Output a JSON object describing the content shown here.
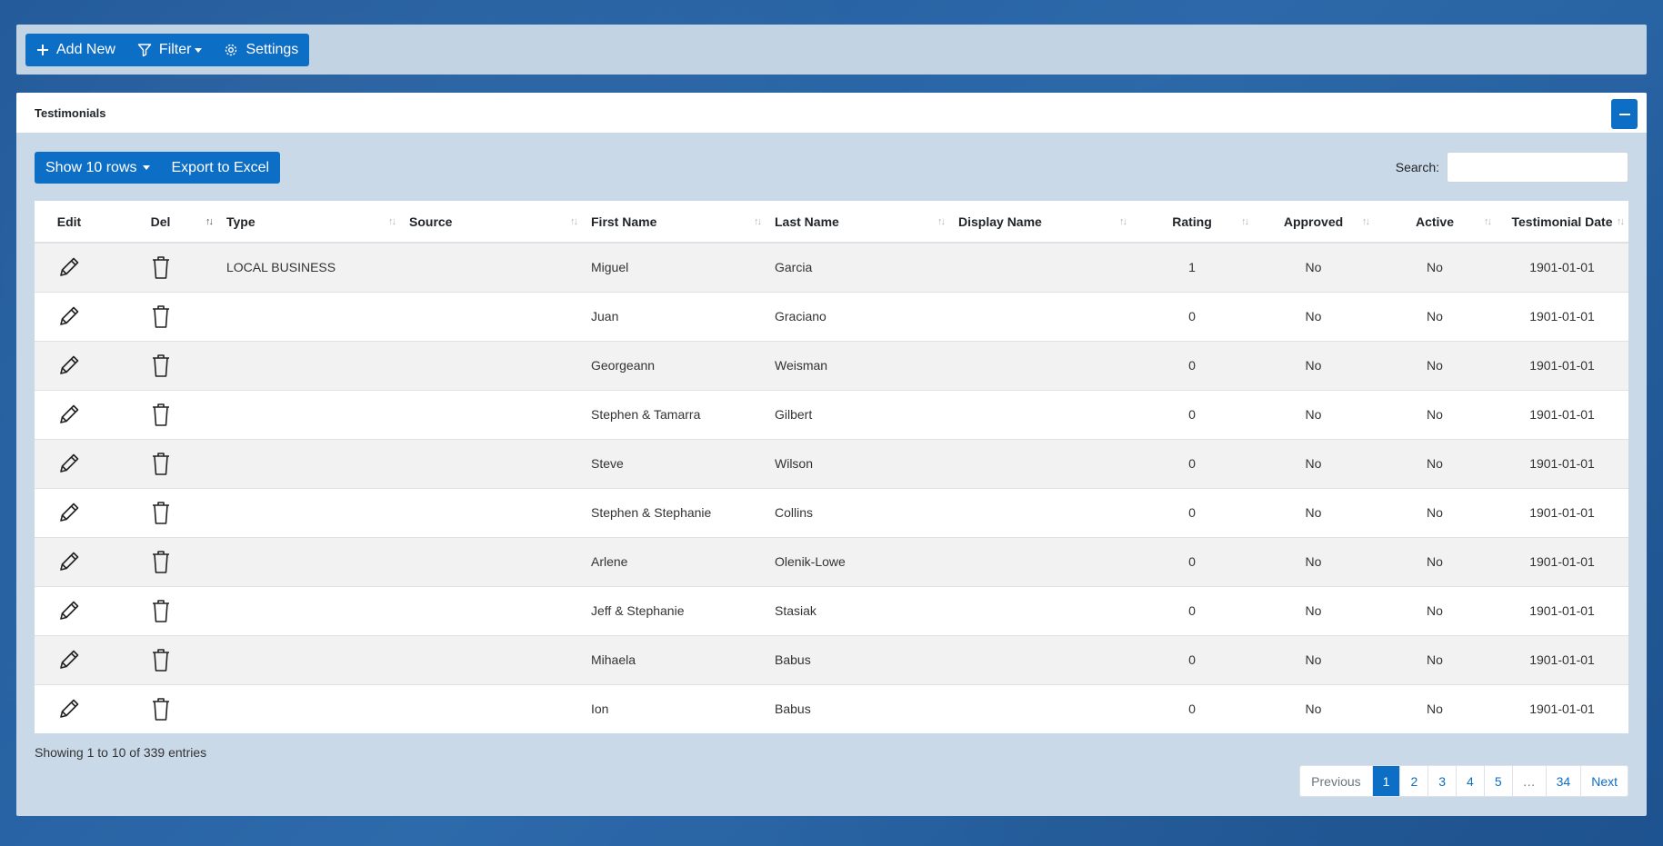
{
  "toolbar": {
    "add_new": "Add New",
    "filter": "Filter",
    "settings": "Settings"
  },
  "panel": {
    "title": "Testimonials"
  },
  "table_toolbar": {
    "show_rows": "Show 10 rows",
    "export": "Export to Excel",
    "search_label": "Search:",
    "search_value": ""
  },
  "table": {
    "headers": {
      "edit": "Edit",
      "del": "Del",
      "type": "Type",
      "source": "Source",
      "first_name": "First Name",
      "last_name": "Last Name",
      "display_name": "Display Name",
      "rating": "Rating",
      "approved": "Approved",
      "active": "Active",
      "testimonial_date": "Testimonial Date"
    },
    "rows": [
      {
        "type": "LOCAL BUSINESS",
        "source": "",
        "first_name": "Miguel",
        "last_name": "Garcia",
        "display_name": "",
        "rating": "1",
        "approved": "No",
        "active": "No",
        "date": "1901-01-01"
      },
      {
        "type": "",
        "source": "",
        "first_name": "Juan",
        "last_name": "Graciano",
        "display_name": "",
        "rating": "0",
        "approved": "No",
        "active": "No",
        "date": "1901-01-01"
      },
      {
        "type": "",
        "source": "",
        "first_name": "Georgeann",
        "last_name": "Weisman",
        "display_name": "",
        "rating": "0",
        "approved": "No",
        "active": "No",
        "date": "1901-01-01"
      },
      {
        "type": "",
        "source": "",
        "first_name": "Stephen & Tamarra",
        "last_name": "Gilbert",
        "display_name": "",
        "rating": "0",
        "approved": "No",
        "active": "No",
        "date": "1901-01-01"
      },
      {
        "type": "",
        "source": "",
        "first_name": "Steve",
        "last_name": "Wilson",
        "display_name": "",
        "rating": "0",
        "approved": "No",
        "active": "No",
        "date": "1901-01-01"
      },
      {
        "type": "",
        "source": "",
        "first_name": "Stephen & Stephanie",
        "last_name": "Collins",
        "display_name": "",
        "rating": "0",
        "approved": "No",
        "active": "No",
        "date": "1901-01-01"
      },
      {
        "type": "",
        "source": "",
        "first_name": "Arlene",
        "last_name": "Olenik-Lowe",
        "display_name": "",
        "rating": "0",
        "approved": "No",
        "active": "No",
        "date": "1901-01-01"
      },
      {
        "type": "",
        "source": "",
        "first_name": "Jeff & Stephanie",
        "last_name": "Stasiak",
        "display_name": "",
        "rating": "0",
        "approved": "No",
        "active": "No",
        "date": "1901-01-01"
      },
      {
        "type": "",
        "source": "",
        "first_name": "Mihaela",
        "last_name": "Babus",
        "display_name": "",
        "rating": "0",
        "approved": "No",
        "active": "No",
        "date": "1901-01-01"
      },
      {
        "type": "",
        "source": "",
        "first_name": "Ion",
        "last_name": "Babus",
        "display_name": "",
        "rating": "0",
        "approved": "No",
        "active": "No",
        "date": "1901-01-01"
      }
    ]
  },
  "footer": {
    "info": "Showing 1 to 10 of 339 entries",
    "pagination": {
      "previous": "Previous",
      "pages": [
        "1",
        "2",
        "3",
        "4",
        "5",
        "…",
        "34"
      ],
      "active": "1",
      "next": "Next"
    }
  },
  "colors": {
    "accent": "#0d6ec6",
    "background": "#2a64a3",
    "panel": "#c9d9e7"
  }
}
